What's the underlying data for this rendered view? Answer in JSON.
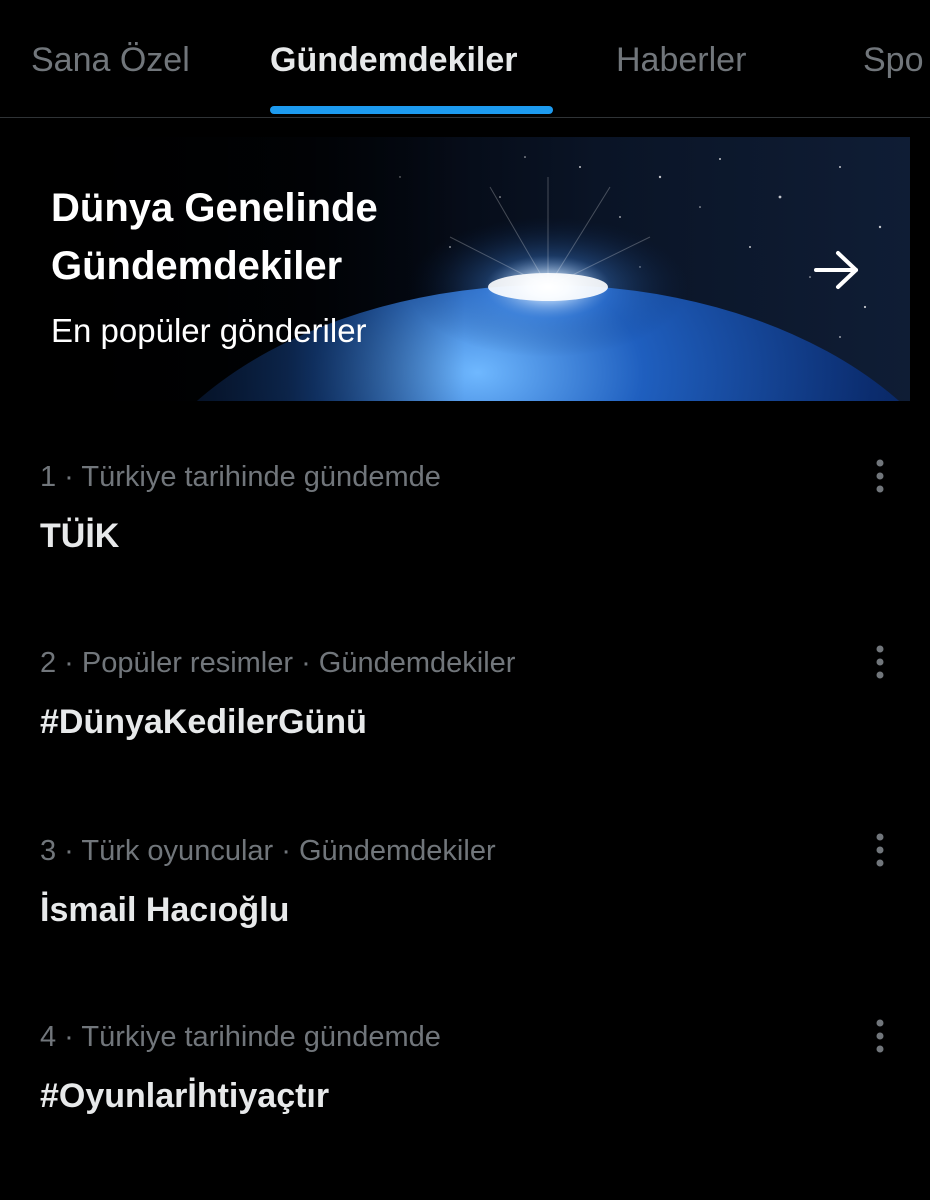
{
  "tabs": [
    {
      "label": "Sana Özel",
      "active": false
    },
    {
      "label": "Gündemdekiler",
      "active": true
    },
    {
      "label": "Haberler",
      "active": false
    },
    {
      "label": "Spo",
      "active": false
    }
  ],
  "banner": {
    "title": "Dünya Genelinde Gündemdekiler",
    "subtitle": "En popüler gönderiler",
    "arrow_icon": "arrow-right-icon"
  },
  "trends": [
    {
      "meta": "1 · Türkiye tarihinde gündemde",
      "name": "TÜİK"
    },
    {
      "meta": "2 · Popüler resimler · Gündemdekiler",
      "name": "#DünyaKedilerGünü"
    },
    {
      "meta": "3 · Türk oyuncular · Gündemdekiler",
      "name": "İsmail Hacıoğlu"
    },
    {
      "meta": "4 · Türkiye tarihinde gündemde",
      "name": "#Oyunlarİhtiyaçtır"
    }
  ],
  "colors": {
    "background": "#000000",
    "accent": "#1d9bf0",
    "text_primary": "#e7e9ea",
    "text_secondary": "#71767b"
  }
}
